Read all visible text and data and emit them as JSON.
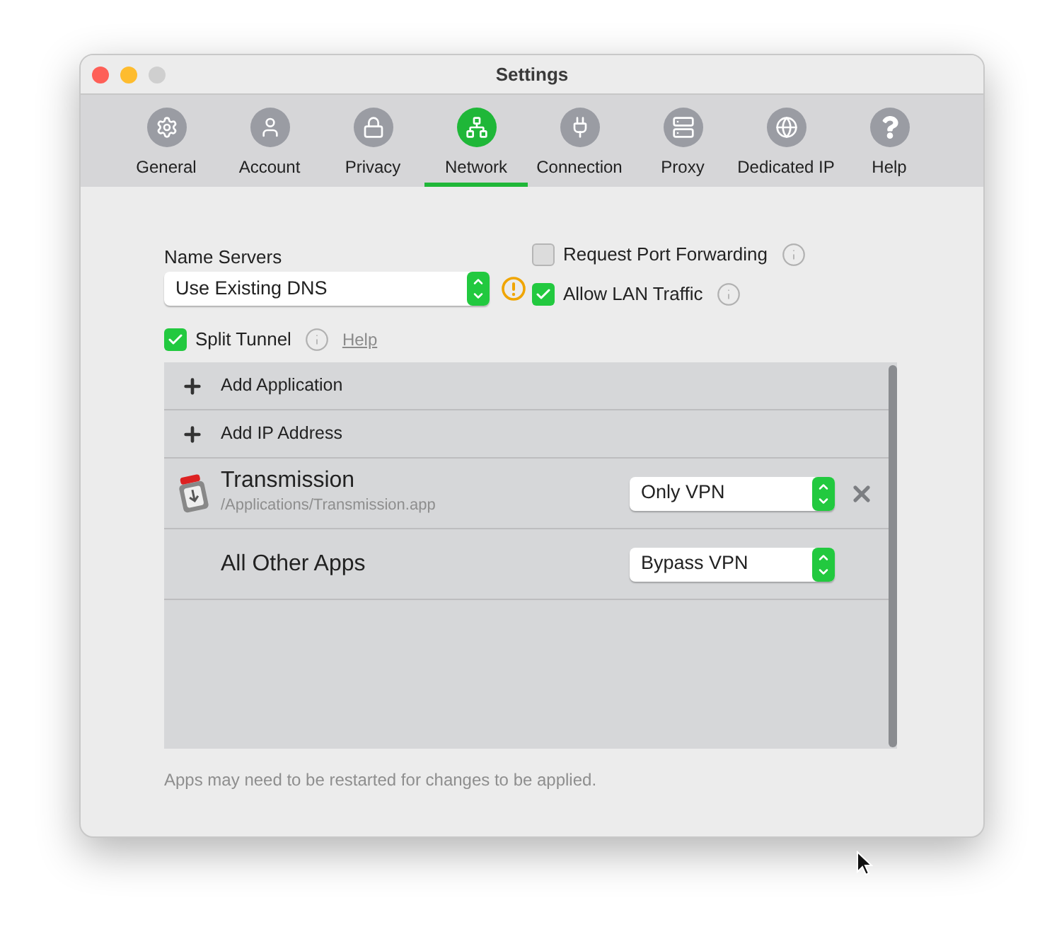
{
  "window": {
    "title": "Settings"
  },
  "tabs": [
    {
      "label": "General",
      "selected": false
    },
    {
      "label": "Account",
      "selected": false
    },
    {
      "label": "Privacy",
      "selected": false
    },
    {
      "label": "Network",
      "selected": true
    },
    {
      "label": "Connection",
      "selected": false
    },
    {
      "label": "Proxy",
      "selected": false
    },
    {
      "label": "Dedicated IP",
      "selected": false
    },
    {
      "label": "Help",
      "selected": false
    }
  ],
  "name_servers": {
    "label": "Name Servers",
    "value": "Use Existing DNS"
  },
  "options": [
    {
      "label": "Request Port Forwarding",
      "checked": false
    },
    {
      "label": "Allow LAN Traffic",
      "checked": true
    }
  ],
  "split_tunnel": {
    "label": "Split Tunnel",
    "checked": true,
    "help_link": "Help"
  },
  "list": [
    {
      "kind": "add",
      "label": "Add Application"
    },
    {
      "kind": "add",
      "label": "Add IP Address"
    },
    {
      "kind": "app",
      "name": "Transmission",
      "path": "/Applications/Transmission.app",
      "mode": "Only VPN"
    },
    {
      "kind": "default",
      "name": "All Other Apps",
      "mode": "Bypass VPN"
    }
  ],
  "footer": "Apps may need to be restarted for changes to be applied."
}
